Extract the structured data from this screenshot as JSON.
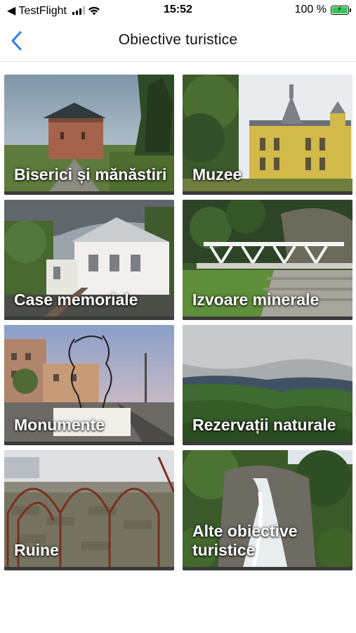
{
  "status_bar": {
    "back_app": "◀ TestFlight",
    "time": "15:52",
    "battery_percent": "100 %"
  },
  "nav": {
    "title": "Obiective turistice"
  },
  "tiles": [
    {
      "label": "Biserici și mănăstiri"
    },
    {
      "label": "Muzee"
    },
    {
      "label": "Case memoriale"
    },
    {
      "label": "Izvoare minerale"
    },
    {
      "label": "Monumente"
    },
    {
      "label": "Rezervații naturale"
    },
    {
      "label": "Ruine"
    },
    {
      "label": "Alte obiective turistice"
    }
  ],
  "colors": {
    "accent": "#2f7cf6",
    "battery": "#34c759"
  }
}
